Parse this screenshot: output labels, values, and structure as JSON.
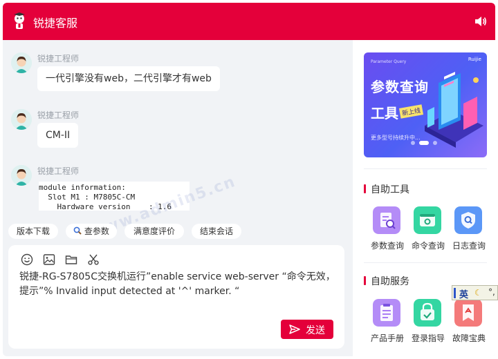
{
  "header": {
    "title": "锐捷客服",
    "speaker_icon": "speaker-icon"
  },
  "messages": [
    {
      "sender": "锐捷工程师",
      "text": "一代引擎没有web，二代引擎才有web"
    },
    {
      "sender": "锐捷工程师",
      "text": "CM-II"
    },
    {
      "sender": "锐捷工程师",
      "code": "module information:\n  Slot M1 : M7805C-CM\n    Hardware version    : 1.6"
    }
  ],
  "quick_actions": [
    "版本下载",
    "查参数",
    "满意度评价",
    "结束会话"
  ],
  "composer": {
    "text": "锐捷-RG-S7805C交换机运行”enable service web-server “命令无效，\n提示”% Invalid input detected at '^' marker. “",
    "send_label": "发送",
    "tool_icons": [
      "emoji-icon",
      "image-icon",
      "folder-icon",
      "scissors-icon"
    ]
  },
  "banner": {
    "line1": "参数查询",
    "line2": "工具",
    "tag": "新上线",
    "caption": "更多型号持续升中...",
    "small_text": "Parameter Query",
    "brand": "Ruijie"
  },
  "sections": {
    "tools": {
      "title": "自助工具",
      "items": [
        {
          "label": "参数查询",
          "color": "#a97cf5"
        },
        {
          "label": "命令查询",
          "color": "#2fcf9c"
        },
        {
          "label": "日志查询",
          "color": "#4f8cf5"
        }
      ]
    },
    "services": {
      "title": "自助服务",
      "items": [
        {
          "label": "产品手册",
          "color": "#a97cf5"
        },
        {
          "label": "登录指导",
          "color": "#2fcf9c"
        },
        {
          "label": "故障宝典",
          "color": "#f26a6a"
        }
      ]
    }
  },
  "ime": {
    "mode": "英",
    "extra": "°,"
  },
  "watermark": "www.admin5.cn",
  "colors": {
    "brand": "#e4003a",
    "background": "#f1f3f6"
  }
}
